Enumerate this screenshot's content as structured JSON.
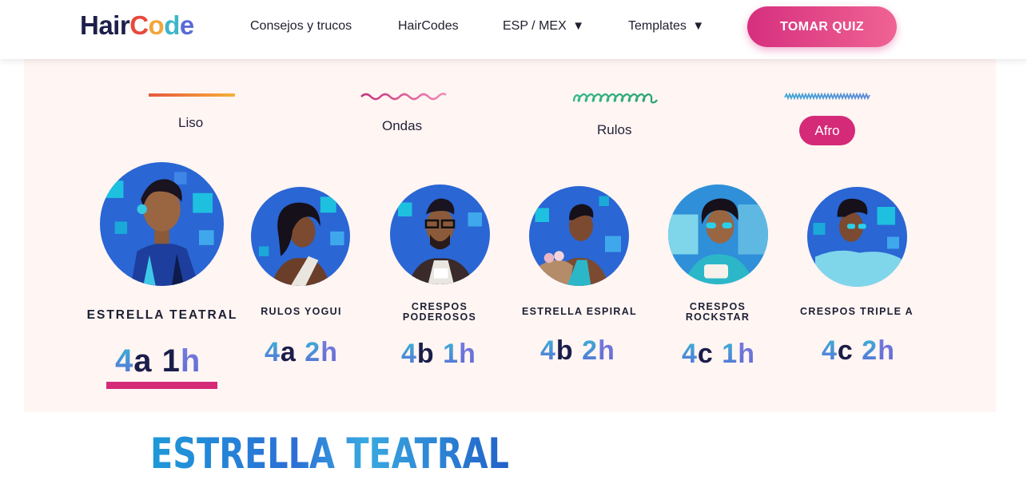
{
  "header": {
    "logo_hair": "Hair",
    "logo_code": "Code",
    "nav": [
      {
        "label": "Consejos y trucos"
      },
      {
        "label": "HairCodes"
      },
      {
        "label": "ESP / MEX",
        "caret": "▼"
      },
      {
        "label": "Templates",
        "caret": "▼"
      }
    ],
    "cta": "TOMAR QUIZ"
  },
  "hair_types": [
    {
      "label": "Liso",
      "icon": "straight-line-icon"
    },
    {
      "label": "Ondas",
      "icon": "wave-line-icon"
    },
    {
      "label": "Rulos",
      "icon": "curl-line-icon"
    },
    {
      "label": "Afro",
      "icon": "zigzag-line-icon",
      "selected": true
    }
  ],
  "profiles": [
    {
      "name": "ESTRELLA TEATRAL",
      "code_num": "4",
      "code_letter": "a",
      "code_num2": "1",
      "code_letter2": "h",
      "selected": true
    },
    {
      "name": "RULOS YOGUI",
      "code_num": "4",
      "code_letter": "a",
      "code_num2": "2",
      "code_letter2": "h"
    },
    {
      "name_line1": "CRESPOS",
      "name_line2": "PODEROSOS",
      "code_num": "4",
      "code_letter": "b",
      "code_num2": "1",
      "code_letter2": "h"
    },
    {
      "name": "ESTRELLA ESPIRAL",
      "code_num": "4",
      "code_letter": "b",
      "code_num2": "2",
      "code_letter2": "h"
    },
    {
      "name_line1": "CRESPOS",
      "name_line2": "ROCKSTAR",
      "code_num": "4",
      "code_letter": "c",
      "code_num2": "1",
      "code_letter2": "h"
    },
    {
      "name": "CRESPOS TRIPLE A",
      "code_num": "4",
      "code_letter": "c",
      "code_num2": "2",
      "code_letter2": "h"
    }
  ],
  "selected_title": "ESTRELLA TEATRAL",
  "colors": {
    "brand_pink": "#d42a78",
    "panel_bg": "#fff5f3",
    "avatar_blue": "#2f6fd6"
  }
}
